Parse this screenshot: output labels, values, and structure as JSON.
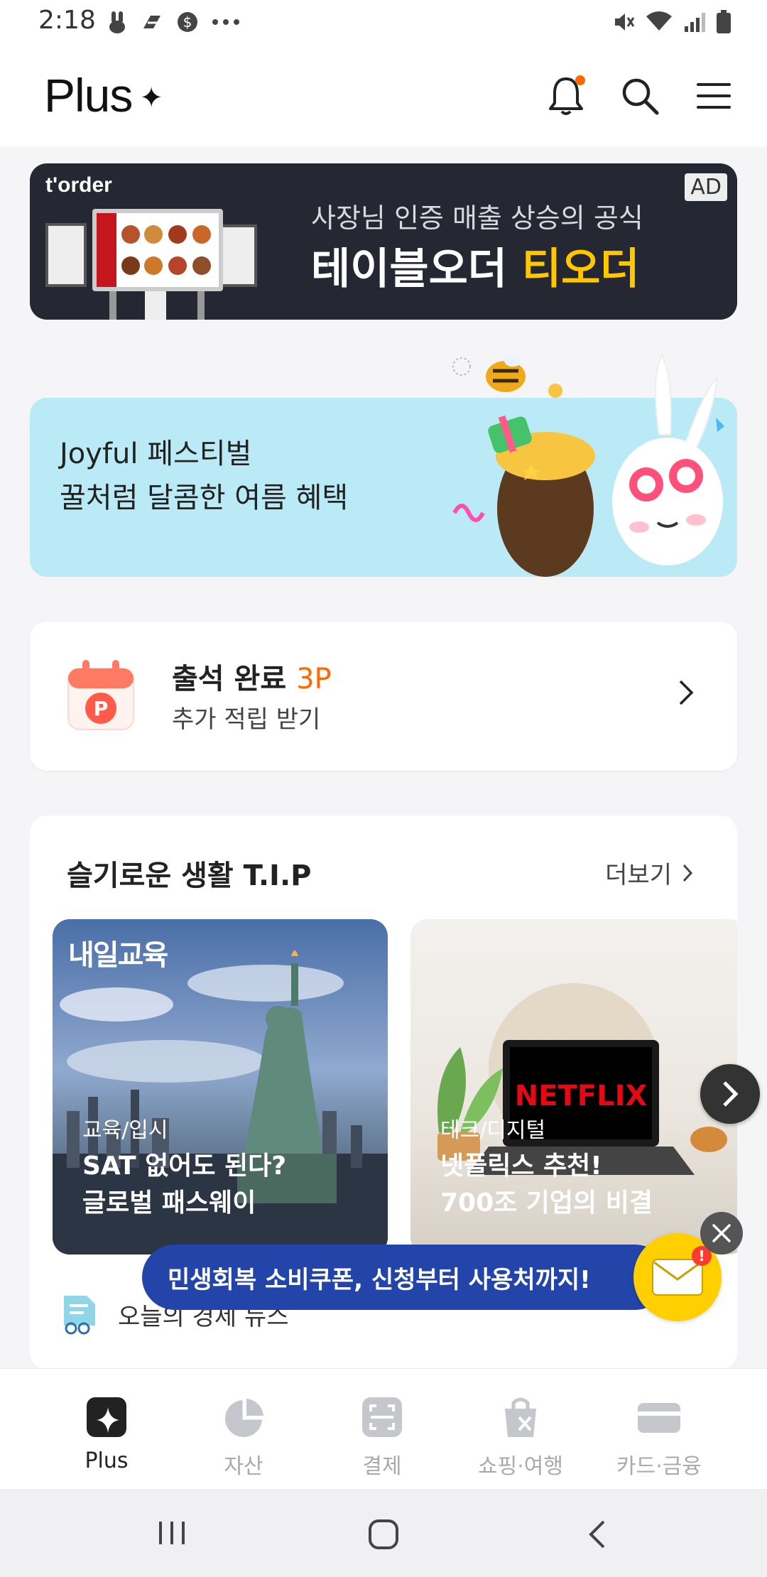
{
  "status_bar": {
    "time": "2:18",
    "left_icons": [
      "rabbit-icon",
      "s-app-icon",
      "s-circle-icon",
      "more-dots-icon"
    ],
    "right_icons": [
      "mute-icon",
      "wifi-icon",
      "signal-icon",
      "battery-icon"
    ]
  },
  "header": {
    "brand": "Plus",
    "brand_mark": "✦",
    "has_notification_dot": true,
    "accent": "#ff6a00"
  },
  "ad_banner": {
    "logo": "t'order",
    "badge": "AD",
    "subtitle": "사장님 인증 매출 상승의 공식",
    "title_main": "테이블오더",
    "title_highlight": "티오더",
    "highlight_color": "#ffc700"
  },
  "festival_banner": {
    "line1": "Joyful 페스티벌",
    "line2": "꿀처럼 달콤한 여름 혜택",
    "bg_color": "#b9eaf5"
  },
  "attendance": {
    "title": "출석 완료",
    "points": "3P",
    "subtitle": "추가 적립 받기",
    "icon": "calendar-point-icon"
  },
  "tips": {
    "title": "슬기로운 생활 T.I.P",
    "more_label": "더보기",
    "cards": [
      {
        "brand": "내일교육",
        "category": "교육/입시",
        "line1": "SAT 없어도 된다?",
        "line2": "글로벌 패스웨이"
      },
      {
        "brand": "NETFLIX",
        "category": "테크/디지털",
        "line1": "넷플릭스 추천!",
        "line2": "700조 기업의 비결"
      }
    ],
    "news_label": "오늘의 경제 뉴스"
  },
  "floating": {
    "coupon_text": "민생회복 소비쿠폰, 신청부터 사용처까지!",
    "mail_badge": "!",
    "pill_color": "#2344a8"
  },
  "bottom_nav": {
    "items": [
      {
        "label": "Plus",
        "icon": "plus-sparkle-icon",
        "active": true
      },
      {
        "label": "자산",
        "icon": "pie-chart-icon",
        "active": false
      },
      {
        "label": "결제",
        "icon": "scan-frame-icon",
        "active": false
      },
      {
        "label": "쇼핑·여행",
        "icon": "shopping-bag-icon",
        "active": false
      },
      {
        "label": "카드·금융",
        "icon": "card-icon",
        "active": false
      }
    ]
  },
  "system_nav": {
    "icons": [
      "recent-apps-icon",
      "home-icon",
      "back-icon"
    ]
  }
}
